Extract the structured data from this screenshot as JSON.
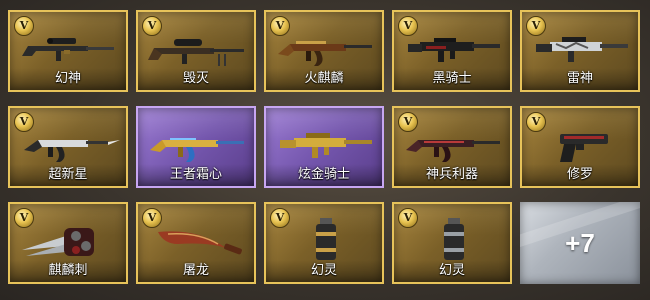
{
  "items": [
    {
      "name": "幻神",
      "badge": "V",
      "frame": "gold",
      "icon": "sniper-rifle-icon"
    },
    {
      "name": "毁灭",
      "badge": "V",
      "frame": "gold",
      "icon": "heavy-sniper-icon"
    },
    {
      "name": "火麒麟",
      "badge": "V",
      "frame": "gold",
      "icon": "ak-rifle-icon"
    },
    {
      "name": "黑骑士",
      "badge": "V",
      "frame": "gold",
      "icon": "assault-rifle-icon"
    },
    {
      "name": "雷神",
      "badge": "V",
      "frame": "gold",
      "icon": "m4-rifle-icon"
    },
    {
      "name": "超新星",
      "badge": "V",
      "frame": "gold",
      "icon": "bayonet-rifle-icon"
    },
    {
      "name": "王者霜心",
      "badge": "",
      "frame": "purple",
      "icon": "ak-rifle-icon"
    },
    {
      "name": "炫金骑士",
      "badge": "",
      "frame": "purple",
      "icon": "m4-rifle-icon"
    },
    {
      "name": "神兵利器",
      "badge": "V",
      "frame": "gold",
      "icon": "ak-rifle-icon"
    },
    {
      "name": "修罗",
      "badge": "V",
      "frame": "gold",
      "icon": "pistol-icon"
    },
    {
      "name": "麒麟刺",
      "badge": "V",
      "frame": "gold",
      "icon": "claw-blade-icon"
    },
    {
      "name": "屠龙",
      "badge": "V",
      "frame": "gold",
      "icon": "kukri-knife-icon"
    },
    {
      "name": "幻灵",
      "badge": "V",
      "frame": "gold",
      "icon": "grenade-canister-icon"
    },
    {
      "name": "幻灵",
      "badge": "V",
      "frame": "gold",
      "icon": "grenade-canister-icon"
    }
  ],
  "more": {
    "label": "+7"
  },
  "colors": {
    "gold_border": "#e7c35a",
    "purple_border": "#c7a6f2",
    "more_bg": "#aeb4bc"
  }
}
